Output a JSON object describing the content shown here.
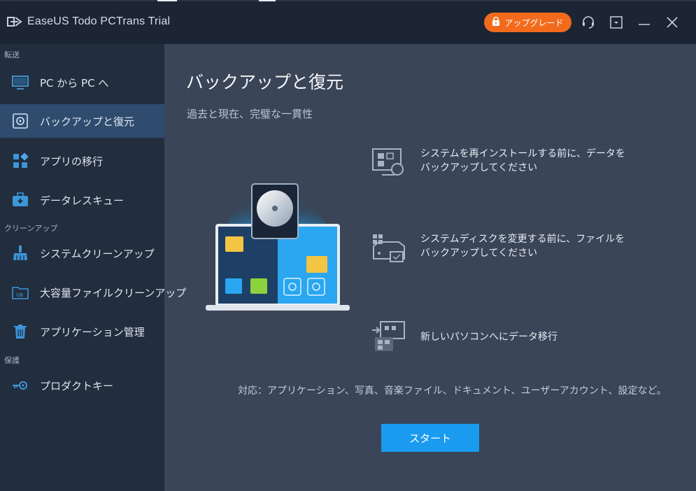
{
  "window": {
    "title": "EaseUS Todo PCTrans Trial",
    "upgrade_label": "アップグレード",
    "icons": [
      "headset-icon",
      "dropdown-icon",
      "minimize-icon",
      "close-icon"
    ]
  },
  "sidebar": {
    "sections": [
      {
        "label": "転送"
      },
      {
        "label": "クリーンアップ"
      },
      {
        "label": "保護"
      }
    ],
    "items": [
      {
        "label": "PC から PC へ",
        "icon": "monitor-icon"
      },
      {
        "label": "バックアップと復元",
        "icon": "backup-disk-icon",
        "active": true
      },
      {
        "label": "アプリの移行",
        "icon": "apps-grid-icon"
      },
      {
        "label": "データレスキュー",
        "icon": "rescue-kit-icon"
      },
      {
        "label": "システムクリーンアップ",
        "icon": "broom-icon"
      },
      {
        "label": "大容量ファイルクリーンアップ",
        "icon": "gb-folder-icon"
      },
      {
        "label": "アプリケーション管理",
        "icon": "trash-icon"
      },
      {
        "label": "プロダクトキー",
        "icon": "key-icon"
      }
    ]
  },
  "main": {
    "title": "バックアップと復元",
    "subtitle": "過去と現在、完璧な一貫性",
    "features": [
      {
        "text": "システムを再インストールする前に、データを\nバックアップしてください",
        "icon": "system-reinstall-icon"
      },
      {
        "text": "システムディスクを変更する前に、ファイルを\nバックアップしてください",
        "icon": "system-disk-icon"
      },
      {
        "text": "新しいパソコンへにデータ移行",
        "icon": "new-pc-transfer-icon"
      }
    ],
    "support_text": "対応：アプリケーション、写真、音楽ファイル、ドキュメント、ユーザーアカウント、設定など。",
    "start_label": "スタート"
  },
  "colors": {
    "accent": "#1b9bf0",
    "upgrade": "#f26b1d",
    "sidebar_bg": "#222d3e",
    "active_item": "#2f4c6f",
    "main_bg": "#3a4557"
  }
}
